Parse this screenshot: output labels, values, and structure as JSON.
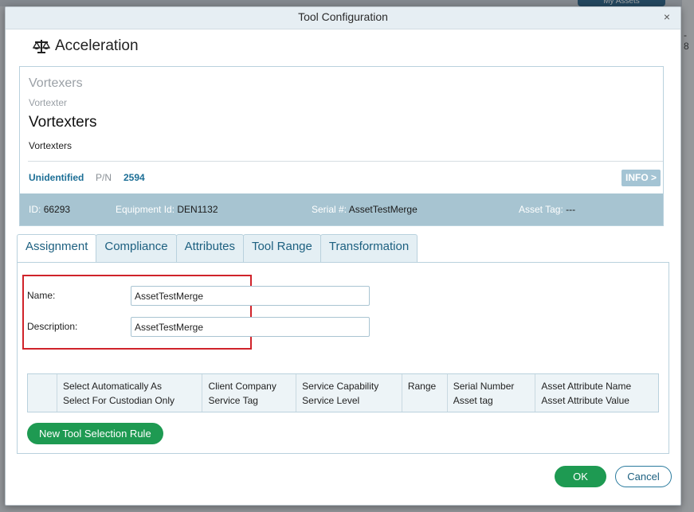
{
  "background": {
    "top_button_label": "My Assets",
    "right_edge_text": "- 8"
  },
  "dialog": {
    "title": "Tool Configuration",
    "close_glyph": "×"
  },
  "tool": {
    "icon": "balance-scale-icon",
    "name": "Acceleration"
  },
  "asset": {
    "family_plural": "Vortexers",
    "family_singular": "Vortexter",
    "name": "Vortexters",
    "description": "Vortexters",
    "status": "Unidentified",
    "pn_label": "P/N",
    "pn_value": "2594",
    "info_button": "INFO >",
    "footer": {
      "id_label": "ID:",
      "id_value": "66293",
      "equipment_label": "Equipment Id:",
      "equipment_value": "DEN1132",
      "serial_label": "Serial #:",
      "serial_value": "AssetTestMerge",
      "tag_label": "Asset Tag:",
      "tag_value": "---"
    }
  },
  "tabs": [
    {
      "label": "Assignment",
      "active": true
    },
    {
      "label": "Compliance",
      "active": false
    },
    {
      "label": "Attributes",
      "active": false
    },
    {
      "label": "Tool Range",
      "active": false
    },
    {
      "label": "Transformation",
      "active": false
    }
  ],
  "assignment": {
    "name_label": "Name:",
    "name_value": "AssetTestMerge",
    "description_label": "Description:",
    "description_value": "AssetTestMerge"
  },
  "rules_table": {
    "columns": [
      {
        "line1": "",
        "line2": ""
      },
      {
        "line1": "Select Automatically As",
        "line2": "Select For Custodian Only"
      },
      {
        "line1": "Client Company",
        "line2": "Service Tag"
      },
      {
        "line1": "Service Capability",
        "line2": "Service Level"
      },
      {
        "line1": "Range",
        "line2": ""
      },
      {
        "line1": "Serial Number",
        "line2": "Asset tag"
      },
      {
        "line1": "Asset Attribute Name",
        "line2": "Asset Attribute Value"
      }
    ]
  },
  "buttons": {
    "new_rule": "New Tool Selection Rule",
    "ok": "OK",
    "cancel": "Cancel"
  },
  "colors": {
    "primary_green": "#1e9a52",
    "accent_blue": "#1d6f96",
    "highlight_red": "#d0232a"
  }
}
